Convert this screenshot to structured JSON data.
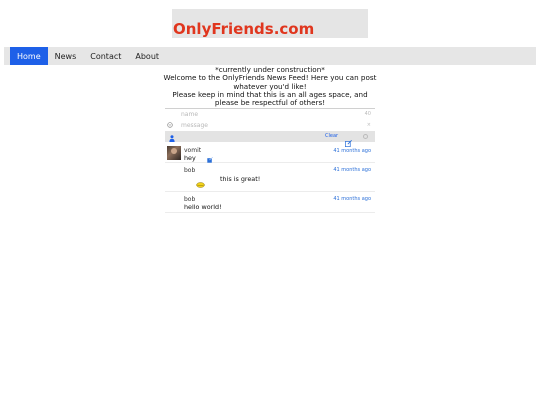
{
  "site": {
    "title": "OnlyFriends.com"
  },
  "nav": {
    "items": [
      "Home",
      "News",
      "Contact",
      "About"
    ],
    "active": "Home"
  },
  "intro": {
    "line1": "*currently under construction*",
    "line2": "Welcome to the OnlyFriends News Feed! Here you can post whatever you'd like!",
    "line3": "Please keep in mind that this is an all ages space, and please be respectful of others!"
  },
  "form": {
    "name_placeholder": "name",
    "message_placeholder": "message",
    "clear_label": "Clear",
    "name_counter": "40",
    "message_counter": "×"
  },
  "posts": [
    {
      "author": "vomit",
      "message": "hey",
      "time": "41 months ago"
    },
    {
      "author": "bob",
      "message": "this is great!",
      "time": "41 months ago"
    },
    {
      "author": "bob",
      "message": "hello world!",
      "time": "41 months ago"
    }
  ],
  "colors": {
    "brand": "#e0361e",
    "accent": "#1e60e8",
    "link": "#2a6fd8"
  }
}
